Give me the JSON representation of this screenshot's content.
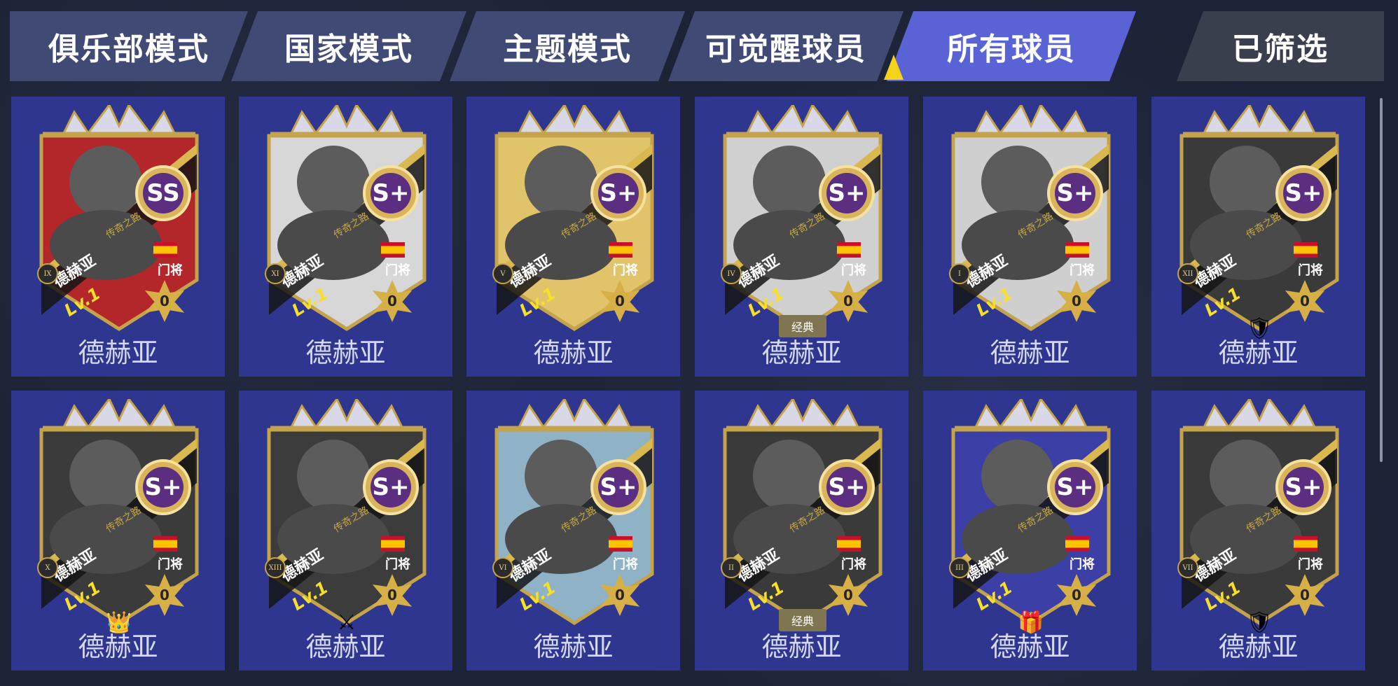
{
  "tabs": [
    {
      "label": "俱乐部模式",
      "active": false
    },
    {
      "label": "国家模式",
      "active": false
    },
    {
      "label": "主题模式",
      "active": false
    },
    {
      "label": "可觉醒球员",
      "active": false
    },
    {
      "label": "所有球员",
      "active": true
    }
  ],
  "filter_label": "已筛选",
  "accent": "#5a63d6",
  "players": [
    {
      "name": "德赫亚",
      "grade": "SS",
      "roman": "IX",
      "position": "门将",
      "level": "Lv.1",
      "stars": "0",
      "road": "传奇之路",
      "card_color": "#b3262a",
      "badge": ""
    },
    {
      "name": "德赫亚",
      "grade": "S+",
      "roman": "XI",
      "position": "门将",
      "level": "Lv.1",
      "stars": "0",
      "road": "传奇之路",
      "card_color": "#d7d7d7",
      "badge": ""
    },
    {
      "name": "德赫亚",
      "grade": "S+",
      "roman": "V",
      "position": "门将",
      "level": "Lv.1",
      "stars": "0",
      "road": "传奇之路",
      "card_color": "#e1c46a",
      "badge": ""
    },
    {
      "name": "德赫亚",
      "grade": "S+",
      "roman": "IV",
      "position": "门将",
      "level": "Lv.1",
      "stars": "0",
      "road": "传奇之路",
      "card_color": "#d0d0d0",
      "badge": "经典"
    },
    {
      "name": "德赫亚",
      "grade": "S+",
      "roman": "I",
      "position": "门将",
      "level": "Lv.1",
      "stars": "0",
      "road": "传奇之路",
      "card_color": "#cfcfcf",
      "badge": ""
    },
    {
      "name": "德赫亚",
      "grade": "S+",
      "roman": "XII",
      "position": "门将",
      "level": "Lv.1",
      "stars": "0",
      "road": "传奇之路",
      "card_color": "#3a3a3a",
      "badge": "🛡"
    },
    {
      "name": "德赫亚",
      "grade": "S+",
      "roman": "X",
      "position": "门将",
      "level": "Lv.1",
      "stars": "0",
      "road": "传奇之路",
      "card_color": "#3b3b3b",
      "badge": "👑"
    },
    {
      "name": "德赫亚",
      "grade": "S+",
      "roman": "XIII",
      "position": "门将",
      "level": "Lv.1",
      "stars": "0",
      "road": "传奇之路",
      "card_color": "#3c3c3c",
      "badge": "⚔"
    },
    {
      "name": "德赫亚",
      "grade": "S+",
      "roman": "VI",
      "position": "门将",
      "level": "Lv.1",
      "stars": "0",
      "road": "传奇之路",
      "card_color": "#8fb2c6",
      "badge": ""
    },
    {
      "name": "德赫亚",
      "grade": "S+",
      "roman": "II",
      "position": "门将",
      "level": "Lv.1",
      "stars": "0",
      "road": "传奇之路",
      "card_color": "#3a3a3a",
      "badge": "经典"
    },
    {
      "name": "德赫亚",
      "grade": "S+",
      "roman": "III",
      "position": "门将",
      "level": "Lv.1",
      "stars": "0",
      "road": "传奇之路",
      "card_color": "#3b3fa6",
      "badge": "🎁"
    },
    {
      "name": "德赫亚",
      "grade": "S+",
      "roman": "VII",
      "position": "门将",
      "level": "Lv.1",
      "stars": "0",
      "road": "传奇之路",
      "card_color": "#3a3a3a",
      "badge": "🛡"
    }
  ]
}
